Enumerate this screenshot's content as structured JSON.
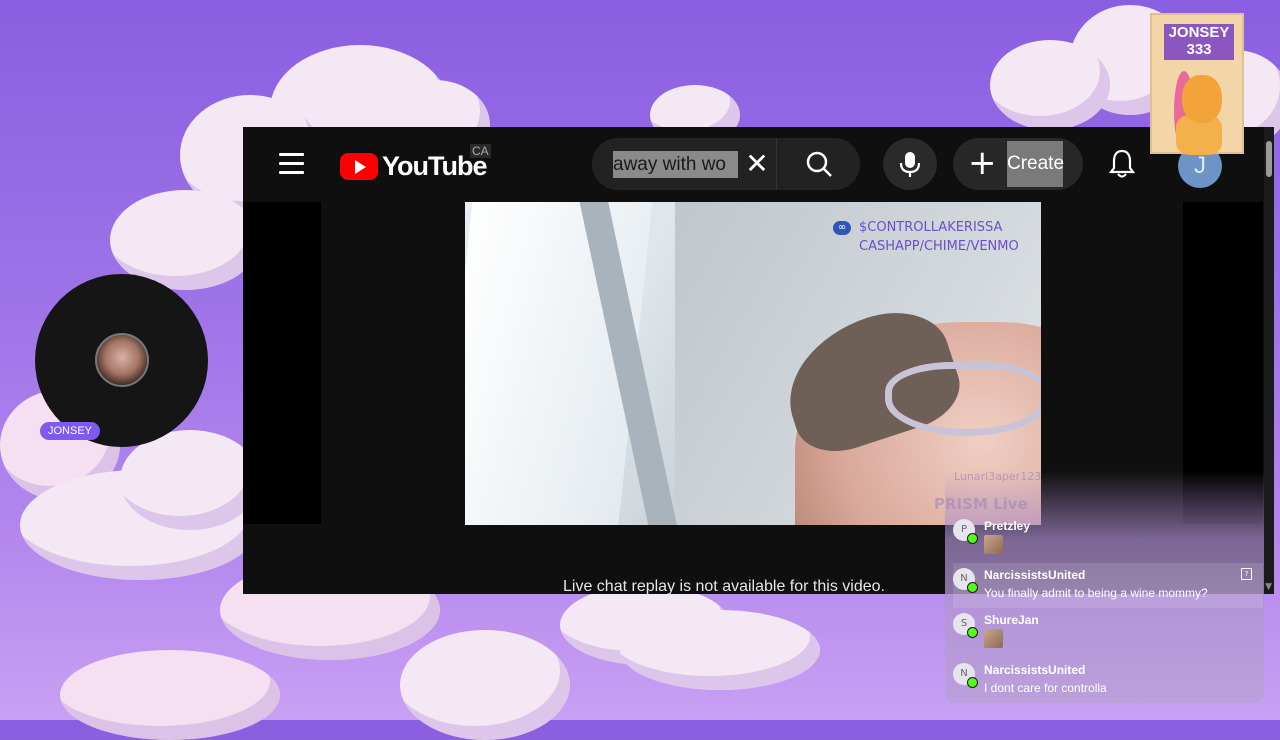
{
  "youtube": {
    "logo_text": "YouTube",
    "region": "CA",
    "search_value": "away with wo",
    "clear_symbol": "✕",
    "create_label": "Create",
    "create_symbol": "+",
    "avatar_initial": "J",
    "live_chat_message": "Live chat replay is not available for this video."
  },
  "video": {
    "watermark_icon": "∞",
    "watermark_line1": "$CONTROLLAKERISSA",
    "watermark_line2": "CASHAPP/CHIME/VENMO"
  },
  "webcam": {
    "name": "JONSEY"
  },
  "sticker": {
    "title_line1": "JONSEY",
    "title_line2": "333"
  },
  "chat": {
    "faded_user": "Lunarl3aper123",
    "faded_label": "PRISM Live",
    "badge_icon": "kick-badge-icon",
    "messages": [
      {
        "initial": "P",
        "user": "Pretzley",
        "text": "",
        "emote": true
      },
      {
        "initial": "N",
        "user": "NarcissistsUnited",
        "text": "You finally admit to being a wine mommy?",
        "emote": false
      },
      {
        "initial": "S",
        "user": "ShureJan",
        "text": "",
        "emote": true
      },
      {
        "initial": "N",
        "user": "NarcissistsUnited",
        "text": "I dont care for controlla",
        "emote": false
      }
    ]
  },
  "colors": {
    "background": "#9e72e8",
    "youtube_red": "#ff0000",
    "kick_green": "#53fc18",
    "name_pill": "#7f5af0"
  }
}
